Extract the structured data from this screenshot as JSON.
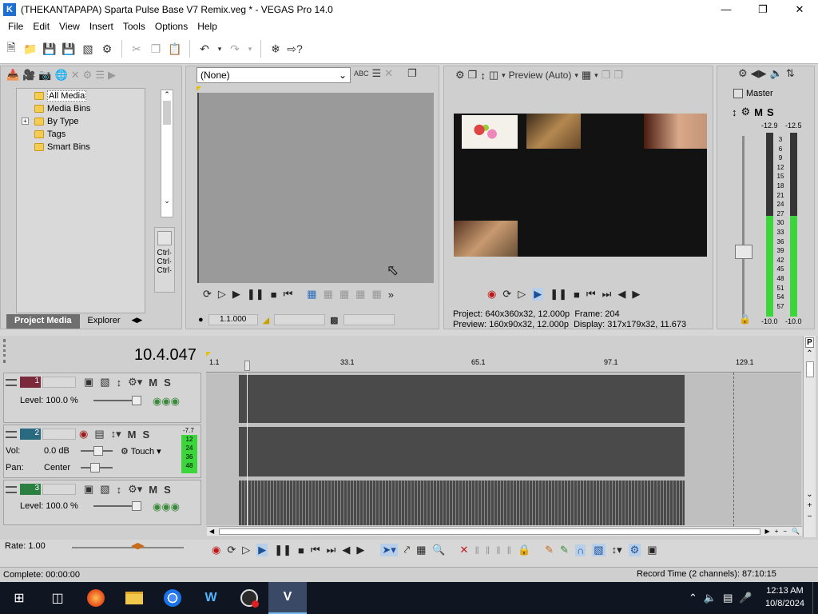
{
  "window": {
    "title": "(THEKANTAPAPA) Sparta Pulse Base V7 Remix.veg * - VEGAS Pro 14.0",
    "app_icon": "vegas-icon"
  },
  "menu": [
    "File",
    "Edit",
    "View",
    "Insert",
    "Tools",
    "Options",
    "Help"
  ],
  "project_media": {
    "tree": [
      {
        "label": "All Media",
        "selected": true,
        "expandable": false
      },
      {
        "label": "Media Bins",
        "selected": false,
        "expandable": false
      },
      {
        "label": "By Type",
        "selected": false,
        "expandable": true
      },
      {
        "label": "Tags",
        "selected": false,
        "expandable": false
      },
      {
        "label": "Smart Bins",
        "selected": false,
        "expandable": false
      }
    ],
    "ctrl_labels": [
      "Ctrl·",
      "Ctrl·",
      "Ctrl·"
    ],
    "tabs": [
      "Project Media",
      "Explorer"
    ],
    "active_tab": "Project Media"
  },
  "trimmer": {
    "dropdown_value": "(None)",
    "time_value": "1.1.000"
  },
  "preview": {
    "quality_label": "Preview (Auto)",
    "project_label": "Project:",
    "project_value": "640x360x32, 12.000p",
    "preview_label": "Preview:",
    "preview_value": "160x90x32, 12.000p",
    "frame_label": "Frame:",
    "frame_value": "204",
    "display_label": "Display:",
    "display_value": "317x179x32, 11.673"
  },
  "master": {
    "label": "Master",
    "mute": "M",
    "solo": "S",
    "peak_left": "-12.9",
    "peak_right": "-12.5",
    "scale": [
      "3",
      "6",
      "9",
      "12",
      "15",
      "18",
      "21",
      "24",
      "27",
      "30",
      "33",
      "36",
      "39",
      "42",
      "45",
      "48",
      "51",
      "54",
      "57"
    ],
    "level_left": "-10.0",
    "level_right": "-10.0",
    "meter_fill_left": 0.55,
    "meter_fill_right": 0.55
  },
  "timeline": {
    "timecode": "10.4.047",
    "ruler": [
      "1.1",
      "33.1",
      "65.1",
      "97.1",
      "129.1"
    ],
    "tracks": [
      {
        "number": "1",
        "type": "video",
        "level_label": "Level:",
        "level_value": "100.0 %",
        "mute": "M",
        "solo": "S",
        "color": "#7a2a3a"
      },
      {
        "number": "2",
        "type": "audio",
        "vol_label": "Vol:",
        "vol_value": "0.0 dB",
        "pan_label": "Pan:",
        "pan_value": "Center",
        "automation": "Touch",
        "mute": "M",
        "solo": "S",
        "meter_top": "-7.7",
        "meter_scale": [
          "12",
          "24",
          "36",
          "48"
        ],
        "color": "#2a6a80"
      },
      {
        "number": "3",
        "type": "video",
        "level_label": "Level:",
        "level_value": "100.0 %",
        "mute": "M",
        "solo": "S",
        "color": "#2a8040"
      }
    ],
    "rate_label": "Rate: 1.00"
  },
  "status": {
    "complete": "Complete: 00:00:00",
    "record_time": "Record Time (2 channels): 87:10:15"
  },
  "taskbar": {
    "time": "12:13 AM",
    "date": "10/8/2024",
    "apps": [
      "start-button",
      "task-view",
      "firefox",
      "file-explorer",
      "chrome",
      "app-w",
      "obs",
      "vegas"
    ]
  }
}
